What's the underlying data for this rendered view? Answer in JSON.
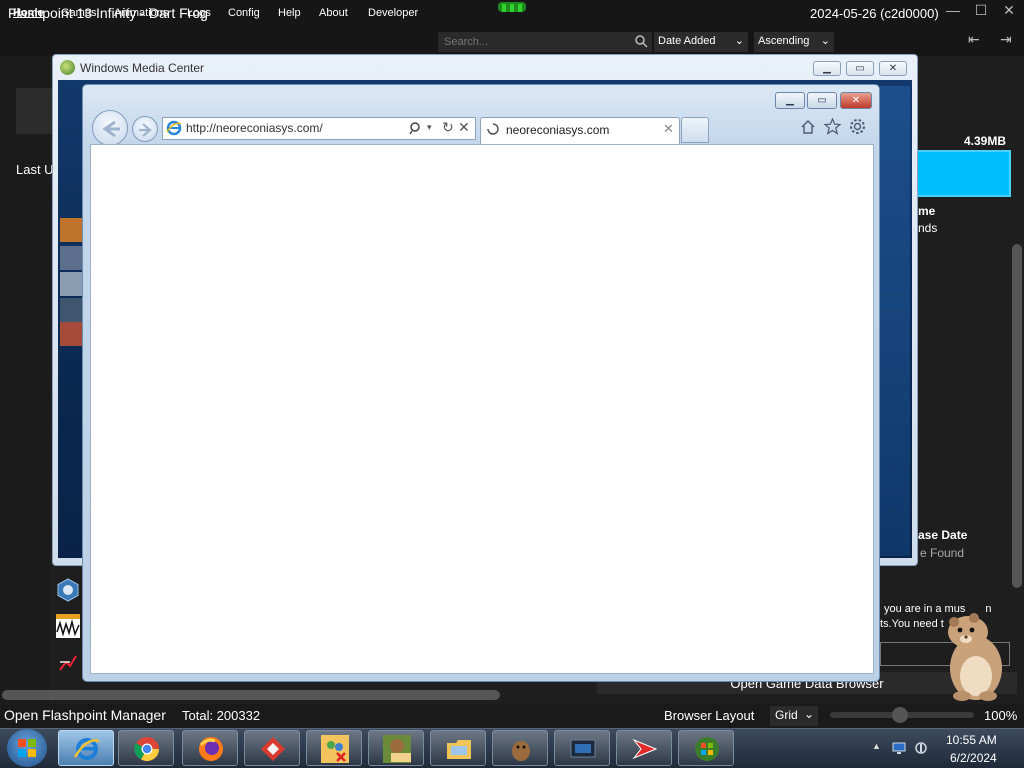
{
  "launcher": {
    "title": "Flashpoint 13 Infinity - Dart Frog",
    "build": "2024-05-26 (c2d0000)",
    "menu": [
      "Home",
      "Games",
      "Animations",
      "Logs",
      "Config",
      "Help",
      "About",
      "Developer"
    ],
    "search_placeholder": "Search...",
    "sort_field": "Date Added",
    "sort_order": "Ascending",
    "left_label": "Last U",
    "right_panel": {
      "size": "4.39MB",
      "title_fragment": "me",
      "subtitle_fragment": "nds",
      "release_label": "ase Date",
      "release_value": "e Found",
      "museum_line1": "you are in a mus",
      "museum_line1_end": "n",
      "museum_line2": "ts.You need t",
      "open_data_browser": "Open Game Data Browser"
    },
    "status_bar": {
      "manager": "Open Flashpoint Manager",
      "total": "Total: 200332",
      "layout_label": "Browser Layout",
      "layout_value": "Grid",
      "zoom": "100%",
      "zoom_level": 0.5
    },
    "colors": {
      "accent": "#00bfff",
      "logo": "#22aa22"
    }
  },
  "wmc": {
    "title": "Windows Media Center",
    "buttons": [
      "minimize-button",
      "maximize-button",
      "close-button"
    ]
  },
  "ie": {
    "url": "http://neoreconiasys.com/",
    "tab_title": "neoreconiasys.com",
    "toolbar_icons": [
      "home-icon",
      "favorites-star-icon",
      "settings-gear-icon"
    ]
  },
  "taskbar": {
    "apps": [
      {
        "name": "internet-explorer",
        "active": true
      },
      {
        "name": "chrome"
      },
      {
        "name": "firefox"
      },
      {
        "name": "gamemaker"
      },
      {
        "name": "windows-live-messenger"
      },
      {
        "name": "beaver-box"
      },
      {
        "name": "file-explorer"
      },
      {
        "name": "beaver"
      },
      {
        "name": "media-center"
      },
      {
        "name": "red-arrow-app"
      },
      {
        "name": "windows-logo-app"
      }
    ],
    "time": "10:55 AM",
    "date": "6/2/2024"
  }
}
